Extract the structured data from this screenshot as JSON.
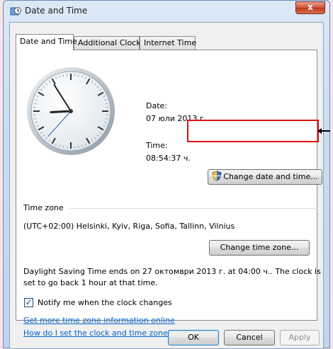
{
  "window": {
    "title": "Date and Time",
    "close_glyph": "x"
  },
  "tabs": [
    {
      "label": "Date and Time",
      "active": true
    },
    {
      "label": "Additional Clocks",
      "active": false
    },
    {
      "label": "Internet Time",
      "active": false
    }
  ],
  "clock": {
    "hour": 8,
    "minute": 54,
    "second": 37
  },
  "date": {
    "label": "Date:",
    "value": "07 юли 2013 г."
  },
  "time": {
    "label": "Time:",
    "value": "08:54:37 ч."
  },
  "buttons": {
    "change_date_time": "Change date and time...",
    "change_time_zone": "Change time zone...",
    "ok": "OK",
    "cancel": "Cancel",
    "apply": "Apply"
  },
  "timezone": {
    "group_label": "Time zone",
    "value": "(UTC+02:00) Helsinki, Kyiv, Riga, Sofia, Tallinn, Vilnius"
  },
  "dst": {
    "line1": "Daylight Saving Time ends on 27 октомври 2013 г. at 04:00 ч.. The clock is",
    "line2": "set to go back 1 hour at that time."
  },
  "notify": {
    "label": "Notify me when the clock changes",
    "checked": true
  },
  "links": {
    "more_info": "Get more time zone information online",
    "how_to": "How do I set the clock and time zone?"
  },
  "colors": {
    "accent_red": "#e01010",
    "link": "#0066cc",
    "close": "#c03a1f"
  },
  "icons": [
    "clock-icon",
    "close-icon",
    "shield-icon",
    "check-icon",
    "arrow-icon"
  ]
}
